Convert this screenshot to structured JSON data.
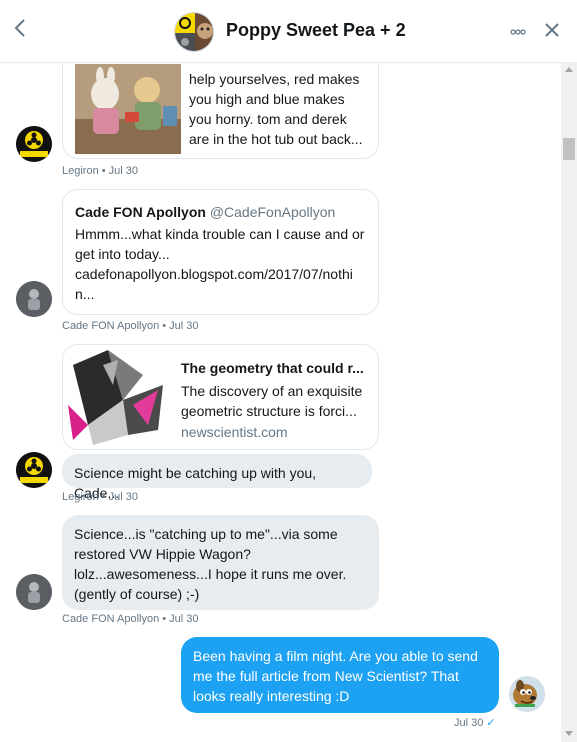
{
  "header": {
    "back": "<",
    "title": "Poppy Sweet Pea + 2",
    "more": "∘∘∘",
    "close": "✕"
  },
  "messages": {
    "m1": {
      "lines": [
        "help yourselves, red makes",
        "you high and blue makes",
        "you horny. tom and derek",
        "are in the hot tub out back..."
      ],
      "meta": "Legiron • Jul 30"
    },
    "m2": {
      "author": "Cade FON Apollyon",
      "handle": "@CadeFonApollyon",
      "lines": [
        "Hmmm...what kinda trouble can I cause and or",
        "get into today...",
        "cadefonapollyon.blogspot.com/2017/07/nothi",
        "n..."
      ],
      "meta": "Cade FON Apollyon • Jul 30"
    },
    "m3": {
      "card_title": "The geometry that could r...",
      "card_desc": [
        "The discovery of an exquisite",
        "geometric structure is forci..."
      ],
      "card_domain": "newscientist.com",
      "text": "Science might be catching up with you, Cade...",
      "meta": "Legiron • Jul 30"
    },
    "m4": {
      "lines": [
        "Science...is \"catching up to me\"...via some",
        "restored VW Hippie Wagon?",
        "lolz...awesomeness...I hope it runs me over.",
        "(gently of course) ;-)"
      ],
      "meta": "Cade FON Apollyon • Jul 30"
    },
    "m5": {
      "lines": [
        "Been having a film night. Are you able to send",
        "me the full article from New Scientist? That",
        "looks really interesting :D"
      ],
      "meta": "Jul 30",
      "status": "✓"
    }
  },
  "avatar_text": {
    "legiron": "Biohazard"
  },
  "colors": {
    "accent": "#1da1f2",
    "bubble_gray": "#e6ecf0",
    "meta_gray": "#657786",
    "biohazard_yellow": "#f5d800"
  }
}
